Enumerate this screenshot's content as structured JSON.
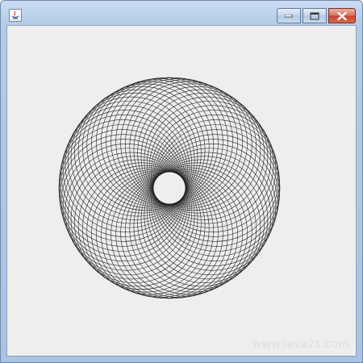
{
  "window": {
    "title": "",
    "controls": {
      "minimize": "minimize",
      "maximize": "maximize",
      "close": "close"
    }
  },
  "canvas": {
    "drawing": "spirograph",
    "stroke_color": "#222222",
    "background_color": "#eeeeee"
  },
  "watermark": {
    "text": "www.java2s.com"
  },
  "colors": {
    "titlebar": "#b4cbe6",
    "close_button": "#c7442b"
  }
}
